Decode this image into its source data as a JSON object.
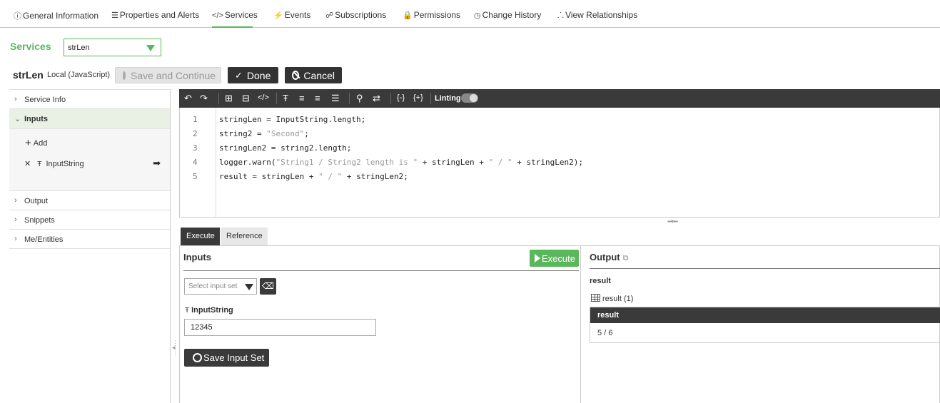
{
  "top_tabs": [
    {
      "icon": "ⓘ",
      "label": "General Information"
    },
    {
      "icon": "☰",
      "label": "Properties and Alerts"
    },
    {
      "icon": "</>",
      "label": "Services"
    },
    {
      "icon": "⚡",
      "label": "Events"
    },
    {
      "icon": "☍",
      "label": "Subscriptions"
    },
    {
      "icon": "🔒",
      "label": "Permissions"
    },
    {
      "icon": "◷",
      "label": "Change History"
    },
    {
      "icon": "⸫",
      "label": "View Relationships"
    }
  ],
  "services": {
    "title": "Services",
    "selected": "strLen"
  },
  "service": {
    "name": "strLen",
    "type": "Local (JavaScript)"
  },
  "buttons": {
    "save_continue": "Save and Continue",
    "done": "Done",
    "cancel": "Cancel"
  },
  "tree": {
    "service_info": "Service Info",
    "inputs": "Inputs",
    "add": "Add",
    "param": "InputString",
    "output": "Output",
    "snippets": "Snippets",
    "me_entities": "Me/Entities"
  },
  "toolbar": {
    "linting_label": "Linting",
    "linting_on": true
  },
  "code": {
    "line_numbers": [
      "1",
      "2",
      "3",
      "4",
      "5"
    ],
    "lines": [
      "stringLen = InputString.length;",
      "string2 = \"Second\";",
      "stringLen2 = string2.length;",
      "logger.warn(\"String1 / String2 length is \" + stringLen + \" / \" + stringLen2);",
      "result = stringLen + \" / \" + stringLen2;"
    ]
  },
  "exec_tabs": {
    "execute": "Execute",
    "reference": "Reference"
  },
  "exec": {
    "inputs_title": "Inputs",
    "execute_button": "Execute",
    "input_set_placeholder": "Select input set",
    "param_label": "InputString",
    "param_value": "12345",
    "save_input_set": "Save Input Set"
  },
  "output": {
    "title": "Output",
    "name": "result",
    "table_label": "result (1)",
    "column": "result",
    "value": "5 / 6"
  },
  "colors": {
    "accent": "#5bb75b",
    "dark": "#3a3a3a"
  }
}
